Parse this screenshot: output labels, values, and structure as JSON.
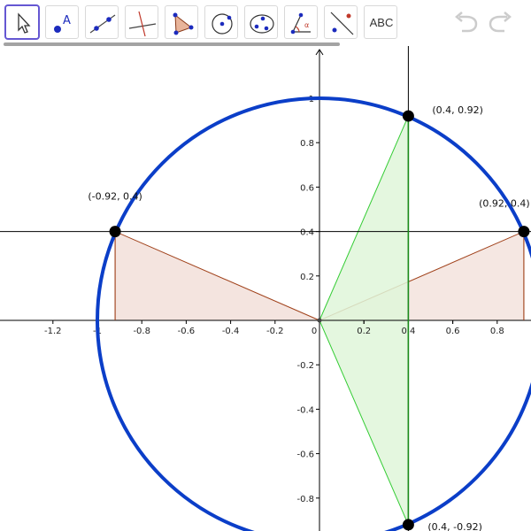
{
  "toolbar": {
    "tools": [
      {
        "name": "move-tool",
        "icon": "arrow-pointer-icon"
      },
      {
        "name": "point-tool",
        "icon": "point-icon"
      },
      {
        "name": "line-tool",
        "icon": "line-icon"
      },
      {
        "name": "perpendicular-tool",
        "icon": "perpendicular-line-icon"
      },
      {
        "name": "polygon-tool",
        "icon": "polygon-icon"
      },
      {
        "name": "circle-tool",
        "icon": "circle-icon"
      },
      {
        "name": "ellipse-tool",
        "icon": "ellipse-icon"
      },
      {
        "name": "angle-tool",
        "icon": "angle-icon"
      },
      {
        "name": "reflect-tool",
        "icon": "reflect-icon"
      },
      {
        "name": "text-tool",
        "icon": "text-icon",
        "label": "ABC"
      }
    ],
    "undo_icon": "undo-icon",
    "redo_icon": "redo-icon"
  },
  "graph": {
    "x_ticks": [
      "-1.2",
      "-1",
      "-0.8",
      "-0.6",
      "-0.4",
      "-0.2",
      "0",
      "0.2",
      "0.4",
      "0.6",
      "0.8"
    ],
    "y_ticks": [
      "1",
      "0.8",
      "0.6",
      "0.4",
      "0.2",
      "-0.2",
      "-0.4",
      "-0.6",
      "-0.8"
    ],
    "points": [
      {
        "label": "(0.4, 0.92)",
        "x": 0.4,
        "y": 0.92
      },
      {
        "label": "(-0.92, 0.4)",
        "x": -0.92,
        "y": 0.4
      },
      {
        "label": "(0.92, 0.4)",
        "x": 0.92,
        "y": 0.4
      },
      {
        "label": "(0.4, -0.92)",
        "x": 0.4,
        "y": -0.92
      }
    ],
    "circle": {
      "center": [
        0,
        0
      ],
      "radius": 1,
      "color": "#0b3ec8"
    },
    "horizontal_line_y": 0.4,
    "vertical_line_x": 0.4,
    "colors": {
      "brown_triangle_fill": "#f4e4df",
      "brown_triangle_stroke": "#a0411a",
      "green_triangle_fill": "#dff6d9",
      "green_triangle_stroke": "#33cc33",
      "vertical_segment": "#1a8a1a",
      "axis": "#000000",
      "accent_tool": "#6557d2"
    }
  }
}
